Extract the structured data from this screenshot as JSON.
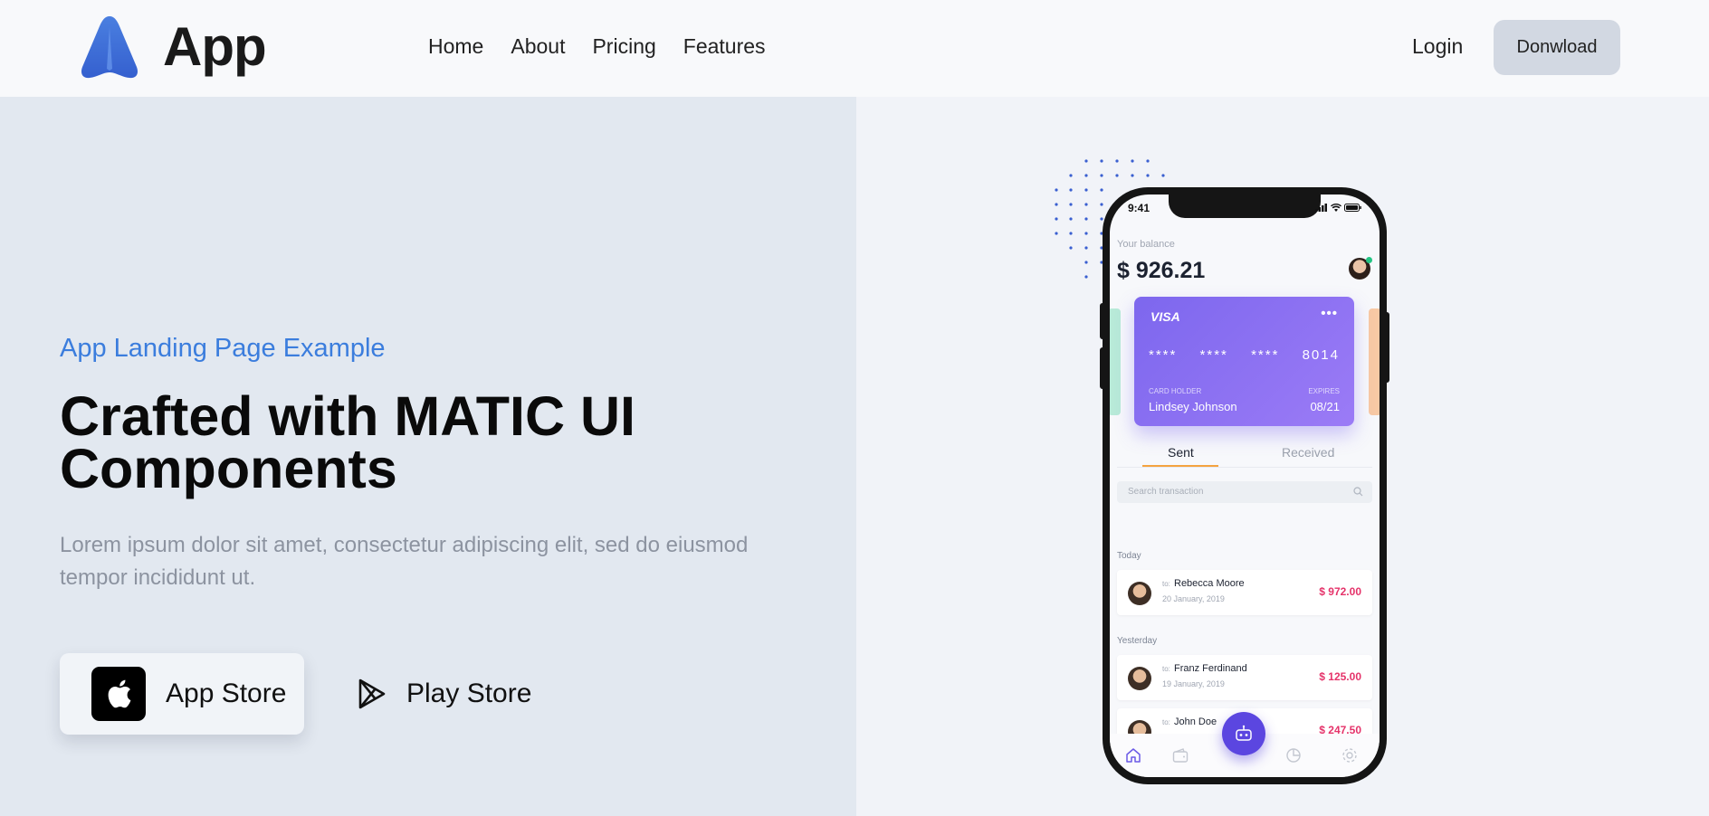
{
  "header": {
    "brand_name": "App",
    "nav": [
      "Home",
      "About",
      "Pricing",
      "Features"
    ],
    "login_label": "Login",
    "download_label": "Donwload"
  },
  "hero": {
    "eyebrow": "App Landing Page Example",
    "headline_line1": "Crafted with MATIC UI",
    "headline_line2": "Components",
    "lead": "Lorem ipsum dolor sit amet, consectetur adipiscing elit, sed do eiusmod tempor incididunt ut.",
    "app_store_label": "App Store",
    "play_store_label": "Play Store"
  },
  "phone": {
    "status_time": "9:41",
    "balance_label": "Your balance",
    "balance_value": "$ 926.21",
    "card": {
      "brand": "VISA",
      "menu": "•••",
      "number_groups": [
        "****",
        "****",
        "****",
        "8014"
      ],
      "holder_label": "CARD HOLDER",
      "holder_name": "Lindsey Johnson",
      "expires_label": "EXPIRES",
      "expires_value": "08/21"
    },
    "tabs": [
      "Sent",
      "Received"
    ],
    "search_placeholder": "Search transaction",
    "groups": {
      "today": "Today",
      "yesterday": "Yesterday"
    },
    "to_label": "to:",
    "transactions": [
      {
        "name": "Rebecca Moore",
        "date": "20 January, 2019",
        "amount": "$ 972.00"
      },
      {
        "name": "Franz Ferdinand",
        "date": "19 January, 2019",
        "amount": "$ 125.00"
      },
      {
        "name": "John Doe",
        "date": "",
        "amount": "$ 247.50"
      }
    ]
  },
  "colors": {
    "accent_blue": "#3b7ddd",
    "card_purple": "#7d67ee",
    "fab_purple": "#5b46e0",
    "amount_red": "#e5336a",
    "tab_orange": "#f4a340"
  },
  "icons": [
    "brand-logo-icon",
    "apple-icon",
    "play-store-icon",
    "search-icon",
    "home-icon",
    "wallet-icon",
    "robot-icon",
    "chart-icon",
    "settings-icon"
  ]
}
